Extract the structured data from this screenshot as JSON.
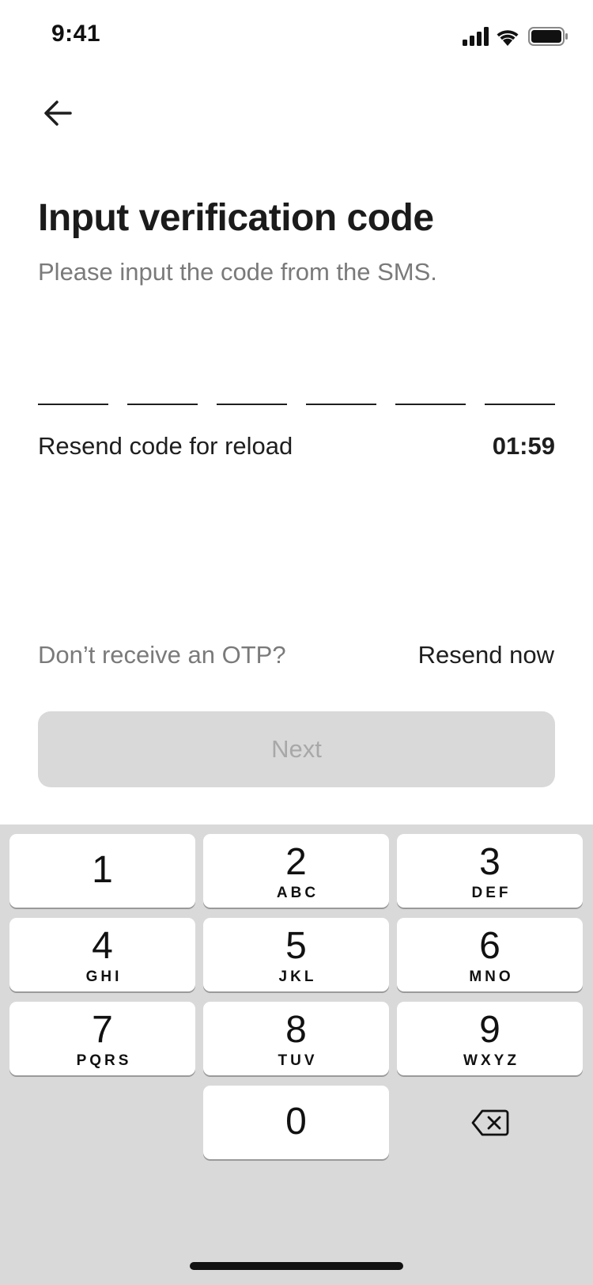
{
  "status_bar": {
    "time": "9:41",
    "signal_icon": "cellular-signal-icon",
    "wifi_icon": "wifi-icon",
    "battery_icon": "battery-icon"
  },
  "nav": {
    "back_icon": "arrow-left-icon"
  },
  "header": {
    "title": "Input verification code",
    "subtitle": "Please input the code from the SMS."
  },
  "otp": {
    "slots": [
      "",
      "",
      "",
      "",
      "",
      ""
    ]
  },
  "resend": {
    "label": "Resend code for reload",
    "timer": "01:59"
  },
  "otp_help": {
    "question": "Don’t receive an OTP?",
    "action": "Resend now"
  },
  "next_button": {
    "label": "Next"
  },
  "keypad": {
    "keys": [
      {
        "digit": "1",
        "letters": ""
      },
      {
        "digit": "2",
        "letters": "ABC"
      },
      {
        "digit": "3",
        "letters": "DEF"
      },
      {
        "digit": "4",
        "letters": "GHI"
      },
      {
        "digit": "5",
        "letters": "JKL"
      },
      {
        "digit": "6",
        "letters": "MNO"
      },
      {
        "digit": "7",
        "letters": "PQRS"
      },
      {
        "digit": "8",
        "letters": "TUV"
      },
      {
        "digit": "9",
        "letters": "WXYZ"
      },
      {
        "digit": "0",
        "letters": ""
      }
    ],
    "backspace_icon": "backspace-icon"
  },
  "colors": {
    "text_primary": "#1e1e1e",
    "text_secondary": "#7a7a7a",
    "button_disabled_bg": "#d9d9d9",
    "button_disabled_text": "#a8a8a8",
    "keypad_bg": "#d9d9d9"
  }
}
